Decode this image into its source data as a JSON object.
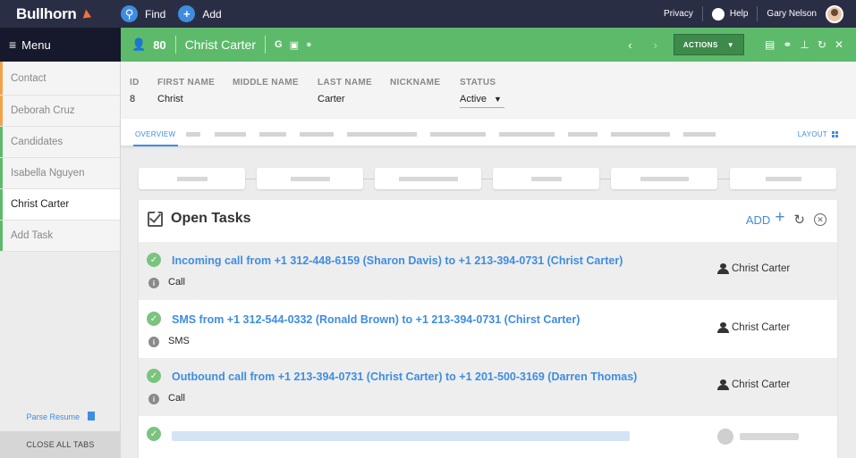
{
  "app": {
    "brand": "Bullhorn",
    "find": "Find",
    "add": "Add",
    "privacy": "Privacy",
    "help": "Help",
    "user": "Gary Nelson"
  },
  "menu": {
    "label": "Menu"
  },
  "record": {
    "count": "80",
    "name": "Christ Carter",
    "actions": "ACTIONS"
  },
  "sidebar": {
    "items": [
      {
        "label": "Contact"
      },
      {
        "label": "Deborah Cruz"
      },
      {
        "label": "Candidates"
      },
      {
        "label": "Isabella Nguyen"
      },
      {
        "label": "Christ Carter"
      },
      {
        "label": "Add Task"
      }
    ],
    "parse_resume": "Parse Resume",
    "close_all": "CLOSE ALL TABS"
  },
  "details": {
    "id_label": "ID",
    "id_value": "8",
    "first_label": "FIRST NAME",
    "first_value": "Christ",
    "middle_label": "MIDDLE NAME",
    "last_label": "LAST NAME",
    "last_value": "Carter",
    "nick_label": "NICKNAME",
    "status_label": "STATUS",
    "status_value": "Active"
  },
  "tabs": {
    "overview": "OVERVIEW",
    "layout": "LAYOUT"
  },
  "tasks": {
    "title": "Open Tasks",
    "add": "ADD",
    "rows": [
      {
        "title": "Incoming call from +1 312-448-6159 (Sharon Davis) to +1 213-394-0731 (Christ Carter)",
        "type": "Call",
        "owner": "Christ Carter"
      },
      {
        "title": "SMS from +1 312-544-0332 (Ronald Brown) to +1 213-394-0731 (Chirst Carter)",
        "type": "SMS",
        "owner": "Christ Carter"
      },
      {
        "title": "Outbound call from +1 213-394-0731 (Christ Carter) to +1 201-500-3169 (Darren Thomas)",
        "type": "Call",
        "owner": "Christ Carter"
      }
    ]
  },
  "colors": {
    "topbar": "#2a2e45",
    "record": "#5dba6b",
    "accent": "#3e8de0",
    "brand_orange": "#f1713a"
  },
  "icons": [
    "search-icon",
    "plus-icon",
    "user-icon",
    "google-icon",
    "linkedin-icon",
    "location-icon",
    "chevron-left-icon",
    "chevron-right-icon",
    "print-icon",
    "link-icon",
    "pin-icon",
    "refresh-icon",
    "close-icon",
    "grid-icon",
    "checkbox-icon",
    "info-icon",
    "person-icon",
    "document-icon"
  ]
}
